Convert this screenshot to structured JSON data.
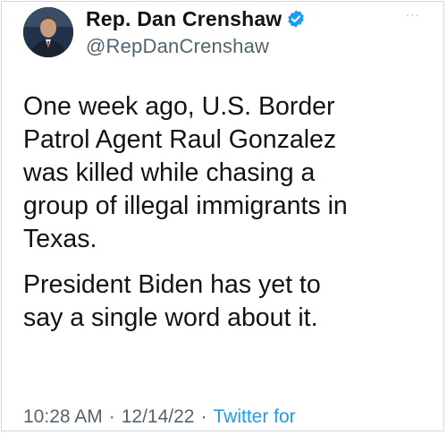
{
  "tweet": {
    "author": {
      "display_name": "Rep. Dan Crenshaw",
      "handle": "@RepDanCrenshaw",
      "verified": true,
      "avatar_icon": "profile-photo"
    },
    "more_icon": "more-options-icon",
    "more_glyph": "···",
    "paragraphs": [
      "One week ago, U.S. Border\nPatrol Agent Raul Gonzalez\nwas killed while chasing a\ngroup of illegal immigrants in\nTexas.",
      "President Biden has yet to\nsay a single word about it."
    ],
    "meta": {
      "time": "10:28 AM",
      "date": "12/14/22",
      "separator": "·",
      "source": "Twitter for"
    }
  },
  "colors": {
    "text_primary": "#0f1419",
    "text_secondary": "#536471",
    "accent": "#1d9bf0",
    "border": "#d6d9dc"
  }
}
